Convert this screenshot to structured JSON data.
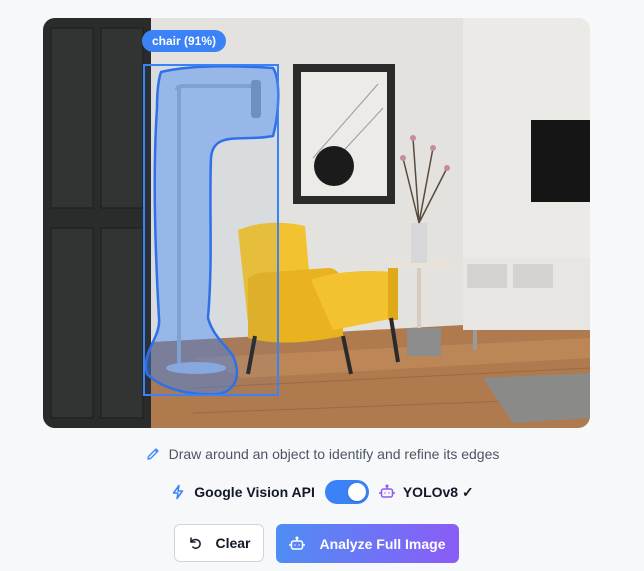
{
  "detection": {
    "label": "chair (91%)"
  },
  "hint": {
    "text": "Draw around an object to identify and refine its edges",
    "icon": "pencil-icon"
  },
  "models": {
    "left_label": "Google Vision API",
    "left_icon": "lightning-icon",
    "right_label": "YOLOv8 ✓",
    "right_icon": "robot-icon",
    "toggle_on": true
  },
  "actions": {
    "clear_label": "Clear",
    "clear_icon": "undo-icon",
    "analyze_label": "Analyze Full Image",
    "analyze_icon": "robot-icon"
  },
  "colors": {
    "accent_blue": "#3b82f6",
    "gradient_start": "#4f8df5",
    "gradient_end": "#8b5cf6",
    "chair_yellow": "#f2c230",
    "floor_wood": "#b07a4f"
  }
}
